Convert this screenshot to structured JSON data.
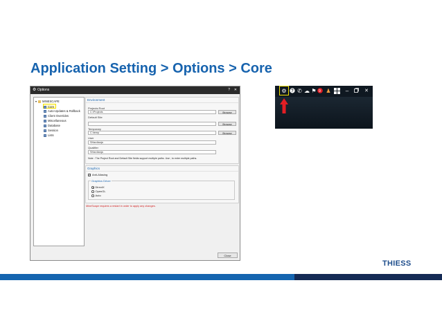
{
  "slide": {
    "title": "Application Setting > Options > Core",
    "brand": "THIESS"
  },
  "window": {
    "title": "Options",
    "help": "?",
    "close": "✕"
  },
  "tree": {
    "root": "MINESCAPE",
    "items": [
      {
        "label": "Core",
        "selected": true
      },
      {
        "label": "Auto-Updates & Rollback"
      },
      {
        "label": "Client Overrides"
      },
      {
        "label": "Miscellaneous"
      },
      {
        "label": "Database"
      },
      {
        "label": "Session"
      },
      {
        "label": "Lists"
      }
    ]
  },
  "environment": {
    "heading": "Environment",
    "projects_root_label": "Projects Root",
    "projects_root_value": "C:\\Projects",
    "default_site_label": "Default Site",
    "default_site_value": "",
    "temporary_label": "Temporary",
    "temporary_value": "C:\\temp",
    "user_label": "User",
    "user_value": "SHardianja",
    "qualifier_label": "Qualifier",
    "qualifier_value": "SHardianja",
    "browse_label": "Browse",
    "note": "Note : The Project Root and Default Site fields support multiple paths. Use ; to enter multiple paths."
  },
  "graphics": {
    "heading": "Graphics",
    "anti_aliasing": "Anti-Aliasing",
    "anti_aliasing_checked": true,
    "driver_heading": "Graphics Driver",
    "drivers": [
      {
        "label": "DirectX",
        "selected": true
      },
      {
        "label": "OpenGL",
        "selected": false
      },
      {
        "label": "Auto",
        "selected": false
      }
    ]
  },
  "restart_notice": "MineScape requires a restart in order to apply any changes.",
  "close_button": "Close",
  "toolbar": {
    "icons": [
      "gear-icon",
      "help-icon",
      "phone-icon",
      "cloud-icon",
      "flag-icon",
      "notification-badge",
      "user-icon",
      "apps-icon",
      "minimize-icon",
      "restore-icon",
      "close-icon"
    ],
    "badge_count": "9",
    "highlight_color": "#f5e100",
    "arrow_color": "#e31e24"
  },
  "colors": {
    "title_blue": "#1763ae",
    "footer_blue": "#1565b0",
    "footer_dark": "#152b55"
  }
}
